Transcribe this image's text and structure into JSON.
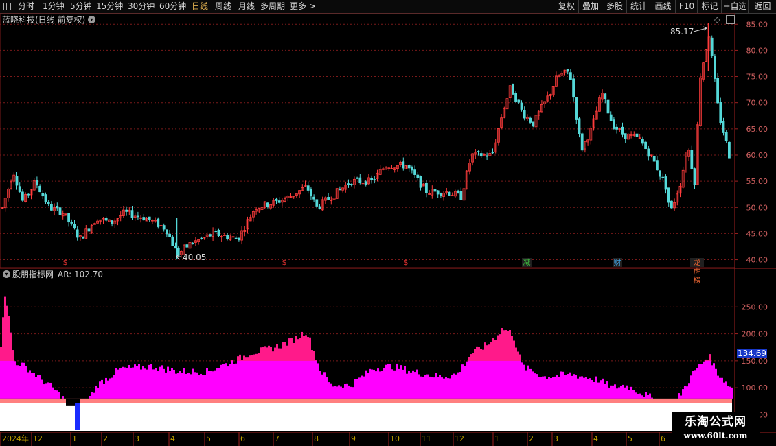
{
  "toolbar": {
    "periods": [
      {
        "label": "分时",
        "x": 0
      },
      {
        "label": "1分钟"
      },
      {
        "label": "5分钟"
      },
      {
        "label": "15分钟"
      },
      {
        "label": "30分钟"
      },
      {
        "label": "60分钟"
      },
      {
        "label": "日线",
        "active": true
      },
      {
        "label": "周线"
      },
      {
        "label": "月线"
      },
      {
        "label": "多周期"
      },
      {
        "label": "更多 >"
      }
    ],
    "tools": [
      "复权",
      "叠加",
      "多股",
      "统计",
      "画线",
      "F10",
      "标记",
      "+自选",
      "返回"
    ]
  },
  "main_panel": {
    "title": "蓝晓科技(日线 前复权)",
    "high_label": "85.17",
    "low_label": "40.05",
    "events": [
      {
        "label": "$",
        "color": "#e03030"
      },
      {
        "label": "$",
        "color": "#e03030"
      },
      {
        "label": "$",
        "color": "#e03030"
      },
      {
        "label": "减",
        "color": "#40c040"
      },
      {
        "label": "财",
        "color": "#40a0e0"
      },
      {
        "label": "龙虎榜",
        "color": "#e06030"
      }
    ]
  },
  "indicator_panel": {
    "title": "股朋指标网",
    "value_label": "AR: 102.70",
    "current_value_badge": "134.69"
  },
  "colors": {
    "up_candle": "#ff3c3c",
    "down_candle": "#54d8d8",
    "grid": "#7a1a1a",
    "ar_bar": "#ff00ff",
    "ar_highlight": "#ff1a8a",
    "band_salmon": "#ff8080",
    "band_white": "#ffffff",
    "blue_marker": "#1a2cff"
  },
  "chart_data": [
    {
      "type": "candlestick",
      "ylim": [
        38.5,
        87
      ],
      "yticks": [
        "85.00",
        "80.00",
        "75.00",
        "70.00",
        "65.00",
        "60.00",
        "55.00",
        "50.00",
        "45.00",
        "40.00"
      ],
      "ytick_values": [
        85,
        80,
        75,
        70,
        65,
        60,
        55,
        50,
        45,
        40
      ],
      "anchors": [
        [
          0,
          49
        ],
        [
          18,
          57
        ],
        [
          32,
          51
        ],
        [
          50,
          55
        ],
        [
          70,
          50
        ],
        [
          90,
          49
        ],
        [
          115,
          44
        ],
        [
          140,
          48
        ],
        [
          160,
          47
        ],
        [
          180,
          49
        ],
        [
          210,
          48
        ],
        [
          240,
          46
        ],
        [
          257,
          41
        ],
        [
          275,
          43
        ],
        [
          310,
          45
        ],
        [
          345,
          44
        ],
        [
          370,
          50
        ],
        [
          400,
          51
        ],
        [
          420,
          52
        ],
        [
          445,
          54
        ],
        [
          460,
          50
        ],
        [
          490,
          53
        ],
        [
          510,
          55
        ],
        [
          540,
          55
        ],
        [
          560,
          58
        ],
        [
          590,
          58
        ],
        [
          620,
          53
        ],
        [
          650,
          53
        ],
        [
          670,
          52
        ],
        [
          685,
          60
        ],
        [
          715,
          60
        ],
        [
          730,
          68
        ],
        [
          742,
          73
        ],
        [
          760,
          68
        ],
        [
          775,
          66
        ],
        [
          800,
          72
        ],
        [
          810,
          75
        ],
        [
          828,
          76
        ],
        [
          845,
          61
        ],
        [
          860,
          65
        ],
        [
          875,
          72
        ],
        [
          890,
          66
        ],
        [
          905,
          64
        ],
        [
          930,
          63
        ],
        [
          950,
          59
        ],
        [
          968,
          54
        ],
        [
          975,
          49
        ],
        [
          990,
          55
        ],
        [
          1000,
          62
        ],
        [
          1010,
          55
        ],
        [
          1018,
          75
        ],
        [
          1031,
          83
        ],
        [
          1045,
          68
        ],
        [
          1055,
          63
        ],
        [
          1064,
          58
        ]
      ],
      "high": {
        "value": 85.17
      },
      "low": {
        "value": 40.05
      }
    },
    {
      "type": "bar",
      "name": "AR",
      "ylim": [
        20,
        300
      ],
      "yticks": [
        "250.00",
        "200.00",
        "150.00",
        "100.00",
        "50.00"
      ],
      "ytick_values": [
        250,
        200,
        150,
        100,
        50
      ],
      "anchors": [
        [
          0,
          170
        ],
        [
          5,
          280
        ],
        [
          10,
          250
        ],
        [
          20,
          150
        ],
        [
          40,
          135
        ],
        [
          70,
          105
        ],
        [
          95,
          75
        ],
        [
          110,
          45
        ],
        [
          125,
          75
        ],
        [
          140,
          105
        ],
        [
          175,
          135
        ],
        [
          220,
          140
        ],
        [
          260,
          130
        ],
        [
          300,
          130
        ],
        [
          340,
          150
        ],
        [
          365,
          165
        ],
        [
          400,
          175
        ],
        [
          420,
          185
        ],
        [
          445,
          205
        ],
        [
          465,
          135
        ],
        [
          480,
          105
        ],
        [
          510,
          105
        ],
        [
          540,
          135
        ],
        [
          570,
          140
        ],
        [
          600,
          130
        ],
        [
          640,
          120
        ],
        [
          665,
          125
        ],
        [
          685,
          165
        ],
        [
          710,
          180
        ],
        [
          730,
          210
        ],
        [
          745,
          200
        ],
        [
          760,
          140
        ],
        [
          790,
          120
        ],
        [
          830,
          125
        ],
        [
          870,
          115
        ],
        [
          890,
          100
        ],
        [
          910,
          105
        ],
        [
          940,
          85
        ],
        [
          960,
          75
        ],
        [
          975,
          60
        ],
        [
          990,
          90
        ],
        [
          1010,
          130
        ],
        [
          1030,
          160
        ],
        [
          1045,
          125
        ],
        [
          1064,
          100
        ]
      ],
      "x_axis": [
        "2024年",
        "12",
        "1",
        "2",
        "3",
        "4",
        "5",
        "6",
        "7",
        "8",
        "9",
        "10",
        "11",
        "12",
        "1",
        "2",
        "3",
        "4",
        "5",
        "6"
      ]
    }
  ]
}
